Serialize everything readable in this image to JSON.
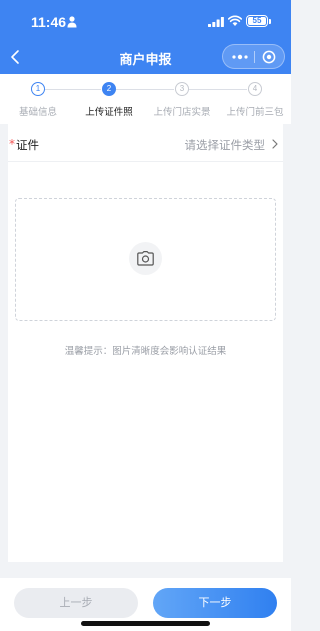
{
  "status": {
    "time": "11:46",
    "battery": "55"
  },
  "nav": {
    "title": "商户申报"
  },
  "steps": [
    {
      "number": "1",
      "label": "基础信息",
      "state": "done"
    },
    {
      "number": "2",
      "label": "上传证件照",
      "state": "active"
    },
    {
      "number": "3",
      "label": "上传门店实景",
      "state": "todo"
    },
    {
      "number": "4",
      "label": "上传门前三包",
      "state": "todo"
    }
  ],
  "form": {
    "required_mark": "*",
    "cert_label": "证件",
    "cert_placeholder": "请选择证件类型"
  },
  "upload": {
    "tip": "温馨提示：图片清晰度会影响认证结果"
  },
  "footer": {
    "prev_label": "上一步",
    "next_label": "下一步"
  },
  "colors": {
    "primary": "#3e84f2",
    "required": "#f25555",
    "muted_text": "#9a9ea6"
  },
  "icons": [
    "person-icon",
    "signal-icon",
    "wifi-icon",
    "back-icon",
    "more-dots-icon",
    "close-circle-icon",
    "chevron-right-icon",
    "camera-icon"
  ]
}
